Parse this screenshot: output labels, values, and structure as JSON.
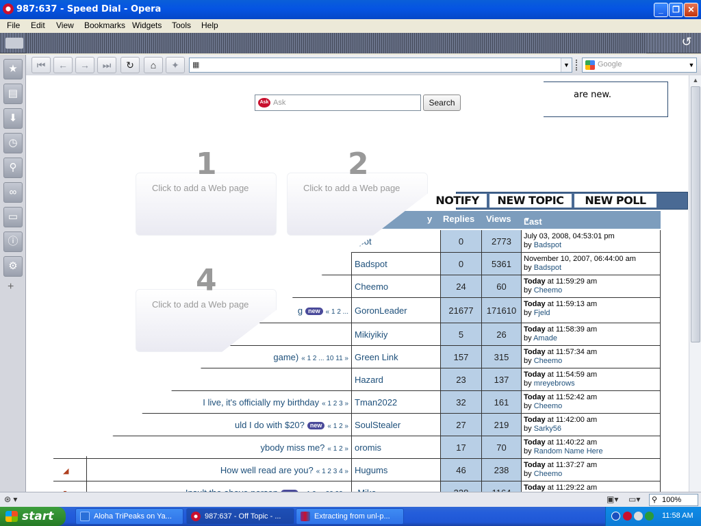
{
  "window": {
    "title": "987:637 - Speed Dial - Opera"
  },
  "menu": [
    "File",
    "Edit",
    "View",
    "Bookmarks",
    "Widgets",
    "Tools",
    "Help"
  ],
  "search": {
    "engine_placeholder": "Google"
  },
  "speed_dial": {
    "ask_placeholder": "Ask",
    "search_button": "Search",
    "dials": [
      {
        "number": "1",
        "caption": "Click to add a Web page"
      },
      {
        "number": "2",
        "caption": "Click to add a Web page"
      },
      {
        "number": "4",
        "caption": "Click to add a Web page"
      }
    ]
  },
  "forum": {
    "notice": "are new.",
    "buttons": [
      "NOTIFY",
      "NEW TOPIC",
      "NEW POLL"
    ],
    "columns": {
      "started_by_fragment": "y",
      "replies": "Replies",
      "views": "Views",
      "last_post": "Last post"
    },
    "rows": [
      {
        "topic": "",
        "started_by": "spot",
        "replies": "0",
        "views": "2773",
        "last_date": "July 03, 2008, 04:53:01 pm",
        "last_by": "Badspot"
      },
      {
        "topic": "",
        "started_by": "Badspot",
        "replies": "0",
        "views": "5361",
        "last_date": "November 10, 2007, 06:44:00 am",
        "last_by": "Badspot"
      },
      {
        "topic": "",
        "started_by": "Cheemo",
        "replies": "24",
        "views": "60",
        "last_today": "Today",
        "last_time": " at 11:59:29 am",
        "last_by": "Cheemo"
      },
      {
        "topic": "g",
        "pages": "« 1 2 ...",
        "new": "new",
        "started_by": "GoronLeader",
        "replies": "21677",
        "views": "171610",
        "last_today": "Today",
        "last_time": " at 11:59:13 am",
        "last_by": "Fjeld"
      },
      {
        "topic": "",
        "started_by": "Mikiyikiy",
        "replies": "5",
        "views": "26",
        "last_today": "Today",
        "last_time": " at 11:58:39 am",
        "last_by": "Amade"
      },
      {
        "topic": "game)",
        "pages": "« 1 2 ... 10 11 »",
        "started_by": "Green Link",
        "replies": "157",
        "views": "315",
        "last_today": "Today",
        "last_time": " at 11:57:34 am",
        "last_by": "Cheemo"
      },
      {
        "topic": "",
        "started_by": "Hazard",
        "replies": "23",
        "views": "137",
        "last_today": "Today",
        "last_time": " at 11:54:59 am",
        "last_by": "mreyebrows"
      },
      {
        "topic": "I live, it's officially my birthday",
        "pages": "« 1 2 3 »",
        "started_by": "Tman2022",
        "replies": "32",
        "views": "161",
        "last_today": "Today",
        "last_time": " at 11:52:42 am",
        "last_by": "Cheemo"
      },
      {
        "topic": "uld I do with $20?",
        "new": "new",
        "pages": "« 1 2 »",
        "started_by": "SoulStealer",
        "replies": "27",
        "views": "219",
        "last_today": "Today",
        "last_time": " at 11:42:00 am",
        "last_by": "Sarky56"
      },
      {
        "topic": "ybody miss me?",
        "pages": "« 1 2 »",
        "started_by": "oromis",
        "replies": "17",
        "views": "70",
        "last_today": "Today",
        "last_time": " at 11:40:22 am",
        "last_by": "Random Name Here"
      },
      {
        "topic": "How well read are you?",
        "pages": "« 1 2 3 4 »",
        "started_by": "Hugums",
        "replies": "46",
        "views": "238",
        "last_today": "Today",
        "last_time": " at 11:37:27 am",
        "last_by": "Cheemo"
      },
      {
        "topic": "Insult the above person",
        "new": "new",
        "pages": "« 1 2 ... 22 23 »",
        "started_by": "-Mike-",
        "replies": "338",
        "views": "1164",
        "last_today": "Today",
        "last_time": " at 11:29:22 am",
        "last_by": ""
      }
    ]
  },
  "status": {
    "zoom": "100%"
  },
  "taskbar": {
    "start": "start",
    "tasks": [
      "Aloha TriPeaks on Ya...",
      "987:637 - Off Topic - ...",
      "Extracting from unl-p..."
    ],
    "clock": "11:58 AM"
  },
  "colors": {
    "titlebar": "#0554e3",
    "forum_header": "#7d9dbd",
    "stat_cells": "#b8cfe6",
    "link": "#1d4f7a",
    "taskbar": "#245edb",
    "start_button": "#2f8a2f"
  }
}
